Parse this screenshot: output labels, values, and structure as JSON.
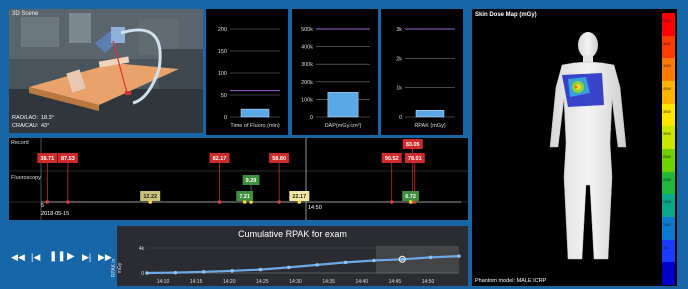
{
  "scene": {
    "title": "3D Scene",
    "rao_lao_label": "RAO/LAO:",
    "rao_lao_value": "18.3°",
    "cra_cau_label": "CRA/CAU:",
    "cra_cau_value": "43°"
  },
  "gauges": [
    {
      "label": "Time of Fluoro (min)",
      "ticks": [
        "200",
        "150",
        "100",
        "50",
        "0"
      ],
      "tick_values": [
        200,
        150,
        100,
        50,
        0
      ],
      "max": 200,
      "value": 18,
      "threshold": 60
    },
    {
      "label": "DAP(mGy.cm²)",
      "ticks": [
        "500k",
        "400k",
        "300k",
        "200k",
        "100k",
        "0"
      ],
      "tick_values": [
        500000,
        400000,
        300000,
        200000,
        100000,
        0
      ],
      "max": 500000,
      "value": 140000,
      "threshold": 500000
    },
    {
      "label": "RPAK (mGy)",
      "ticks": [
        "3k",
        "2k",
        "1k",
        "0"
      ],
      "tick_values": [
        3000,
        2000,
        1000,
        0
      ],
      "max": 3000,
      "value": 230,
      "threshold": 3000
    }
  ],
  "record": {
    "record_label": "Record",
    "fluoroscopy_label": "Fluoroscopy",
    "date": "2018-05-15",
    "start_marker": "5",
    "time_label": "14:50",
    "markers": [
      {
        "text": "38.71",
        "pos": 0.015,
        "row": "top",
        "color": "#d12a2a"
      },
      {
        "text": "87.53",
        "pos": 0.064,
        "row": "top",
        "color": "#d12a2a"
      },
      {
        "text": "82.17",
        "pos": 0.425,
        "row": "top",
        "color": "#d12a2a"
      },
      {
        "text": "58.80",
        "pos": 0.567,
        "row": "top",
        "color": "#d12a2a"
      },
      {
        "text": "83.05",
        "pos": 0.885,
        "row": "top2",
        "color": "#d12a2a"
      },
      {
        "text": "90.52",
        "pos": 0.835,
        "row": "top",
        "color": "#d12a2a"
      },
      {
        "text": "78.01",
        "pos": 0.89,
        "row": "top",
        "color": "#d12a2a"
      },
      {
        "text": "9.29",
        "pos": 0.5,
        "row": "mid",
        "color": "#3f8f3f"
      },
      {
        "text": "12.22",
        "pos": 0.26,
        "row": "low",
        "color": "#c9c27a"
      },
      {
        "text": "7.21",
        "pos": 0.485,
        "row": "low",
        "color": "#3f8f3f"
      },
      {
        "text": "22.17",
        "pos": 0.615,
        "row": "low",
        "color": "#f3e9a3"
      },
      {
        "text": "6.72",
        "pos": 0.88,
        "row": "low",
        "color": "#3f8f3f"
      }
    ]
  },
  "controls": {
    "rewind": "◀◀",
    "step_back": "|◀",
    "pause": "❚❚",
    "play": "▶",
    "step_forward": "▶|",
    "fast_forward": "▶▶"
  },
  "cumulative": {
    "title": "Cumulative RPAK for exam",
    "ylabel": "RPAK in mGy",
    "y_ticks": [
      "4k",
      "0"
    ],
    "x_ticks": [
      "14:10",
      "14:15",
      "14:20",
      "14:25",
      "14:30",
      "14:35",
      "14:40",
      "14:45",
      "14:50"
    ]
  },
  "chart_data": {
    "type": "line",
    "title": "Cumulative RPAK for exam",
    "xlabel": "",
    "ylabel": "RPAK in mGy",
    "x": [
      "14:07",
      "14:10",
      "14:15",
      "14:20",
      "14:25",
      "14:30",
      "14:35",
      "14:40",
      "14:43",
      "14:45",
      "14:50",
      "14:53"
    ],
    "values": [
      0,
      60,
      200,
      350,
      550,
      900,
      1300,
      1700,
      2000,
      2200,
      2500,
      2700
    ],
    "ylim": [
      0,
      4000
    ]
  },
  "skin_map": {
    "title": "Skin Dose Map (mGy)",
    "phantom_label": "Phantom model: MALE ICRP",
    "scale_ticks": [
      "5000",
      "3600",
      "3400",
      "4000",
      "3500",
      "3000",
      "2500",
      "2000",
      "1500",
      "1000",
      "500",
      "0"
    ],
    "scale_colors": [
      "#ff0000",
      "#ff3a00",
      "#ff7a00",
      "#ffb400",
      "#ffe600",
      "#c8e600",
      "#6fd200",
      "#1fb83a",
      "#0aa88a",
      "#0a7ad0",
      "#1a3aff",
      "#0000c8"
    ]
  },
  "colors": {
    "background": "#1767a8",
    "bar_fill": "#5aa9e6",
    "threshold": "#9a63d8",
    "red_flag": "#d12a2a",
    "green_flag": "#3f8f3f"
  }
}
